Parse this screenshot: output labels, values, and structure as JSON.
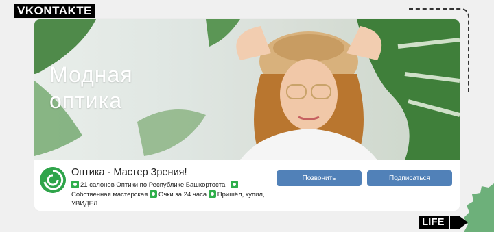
{
  "source_tag": "VKONTAKTE",
  "footer_tag": "LIFE",
  "cover": {
    "title_line1": "Модная",
    "title_line2": "оптика"
  },
  "group": {
    "name": "Оптика - Мастер Зрения!",
    "desc_1": "21 салонов Оптики по Республике Башкортостан",
    "desc_2": "Собственная мастерская",
    "desc_3": "Очки за 24 часа",
    "desc_4": "Пришёл, купил, УВИДЕЛ"
  },
  "buttons": {
    "call": "Позвонить",
    "subscribe": "Подписаться"
  },
  "colors": {
    "button": "#5181b8",
    "emoji_green": "#2fae4b",
    "accent_green": "#6db07a"
  }
}
